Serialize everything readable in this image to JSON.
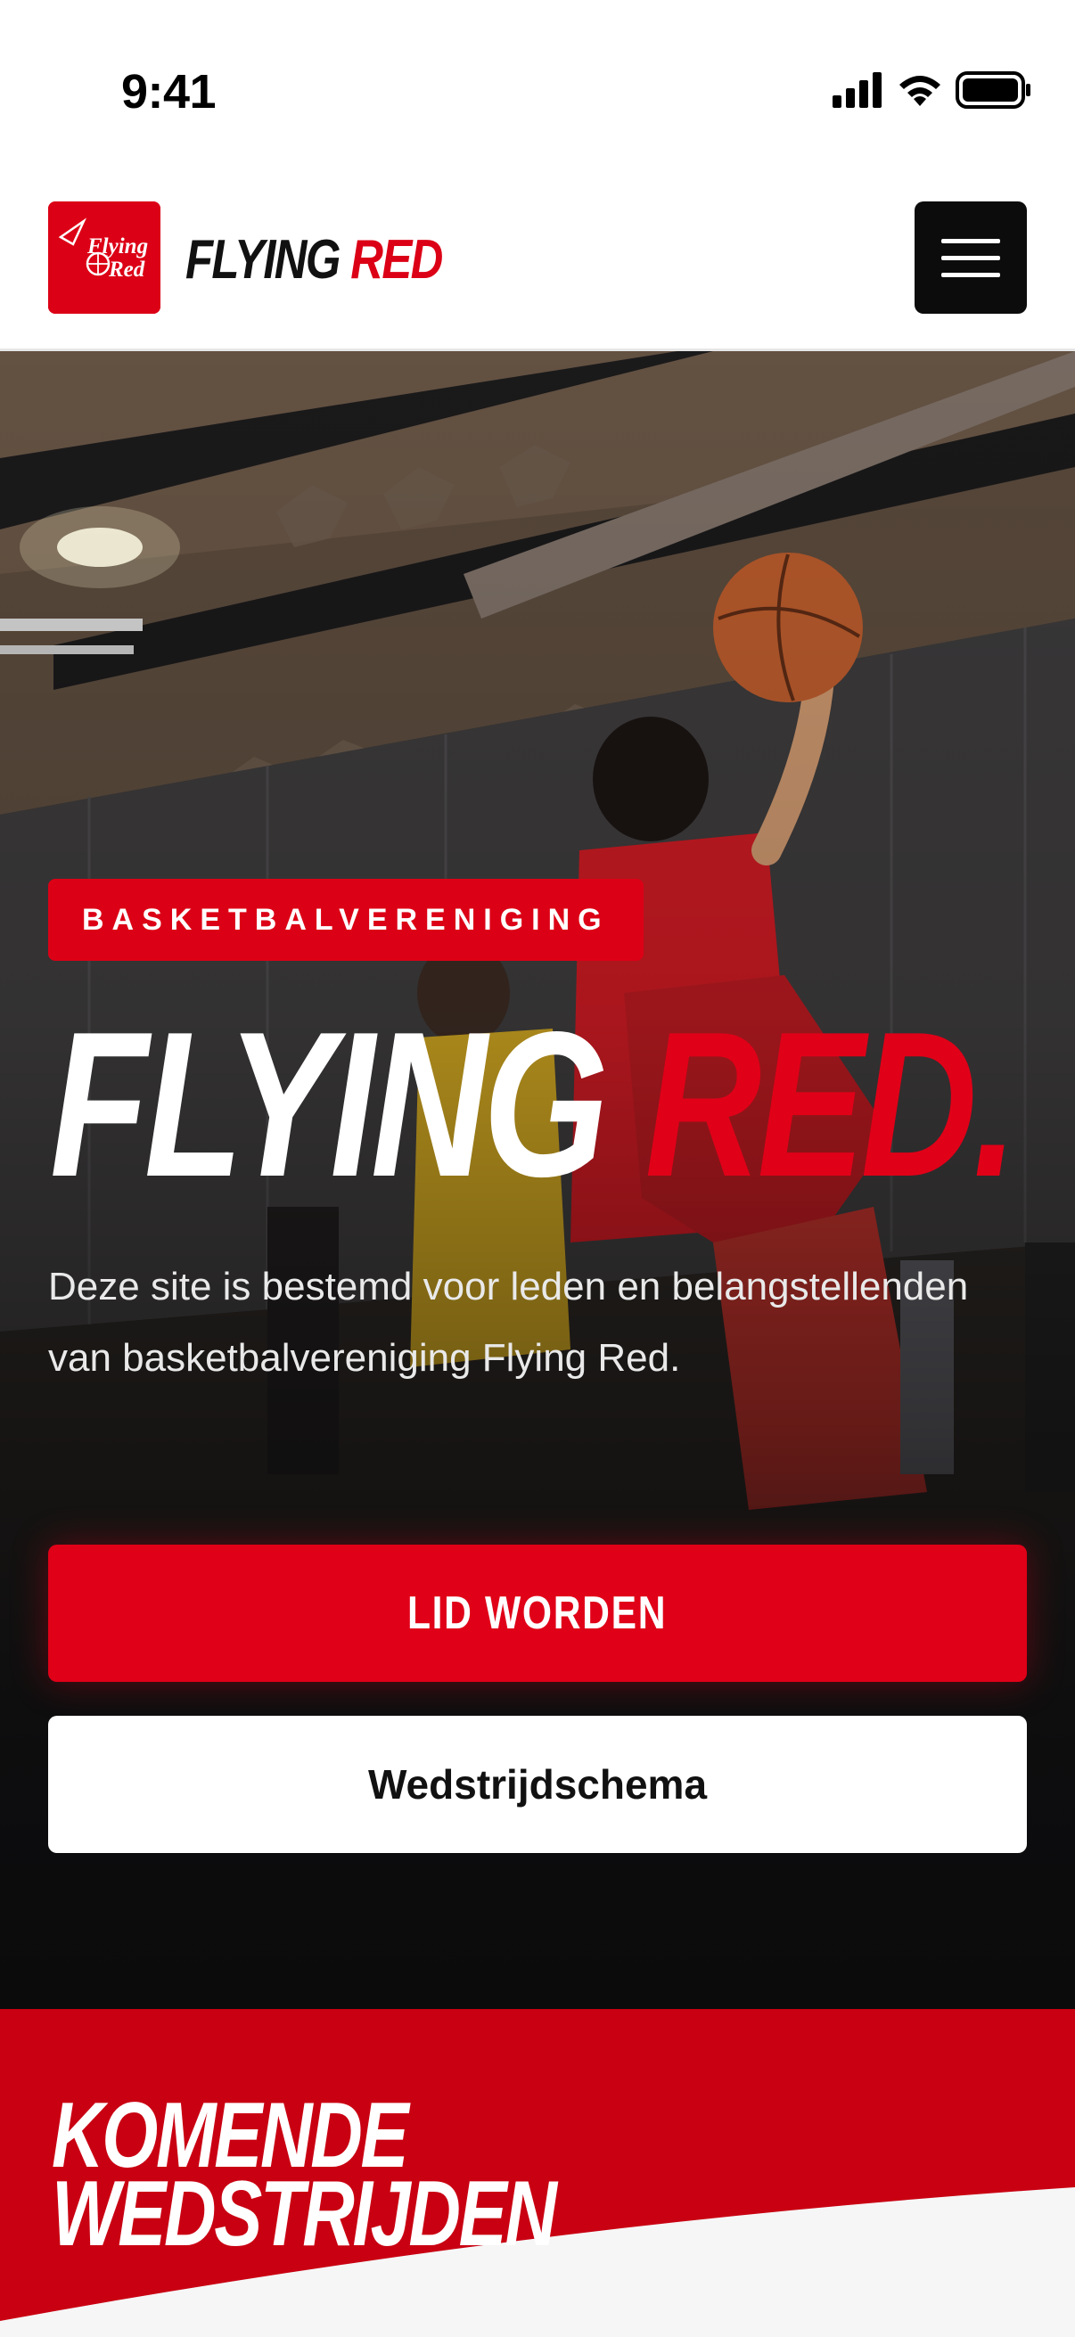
{
  "status_bar": {
    "time": "9:41"
  },
  "header": {
    "logo_text_line1": "Flying",
    "logo_text_line2": "Red",
    "brand_white": "FLYING",
    "brand_red": "RED"
  },
  "hero": {
    "badge": "BASKETBALVERENIGING",
    "title_white": "FLYING",
    "title_red": "RED.",
    "description": "Deze site is bestemd voor leden en belangstellenden van basketbalvereniging Flying Red.",
    "primary_button": "LID WORDEN",
    "secondary_button": "Wedstrijdschema"
  },
  "upcoming": {
    "title_line1": "KOMENDE",
    "title_line2": "WEDSTRIJDEN"
  },
  "colors": {
    "brand_red": "#dc0016",
    "dark": "#0c0c0c"
  },
  "icons": [
    "signal-icon",
    "wifi-icon",
    "battery-icon",
    "menu-icon"
  ]
}
